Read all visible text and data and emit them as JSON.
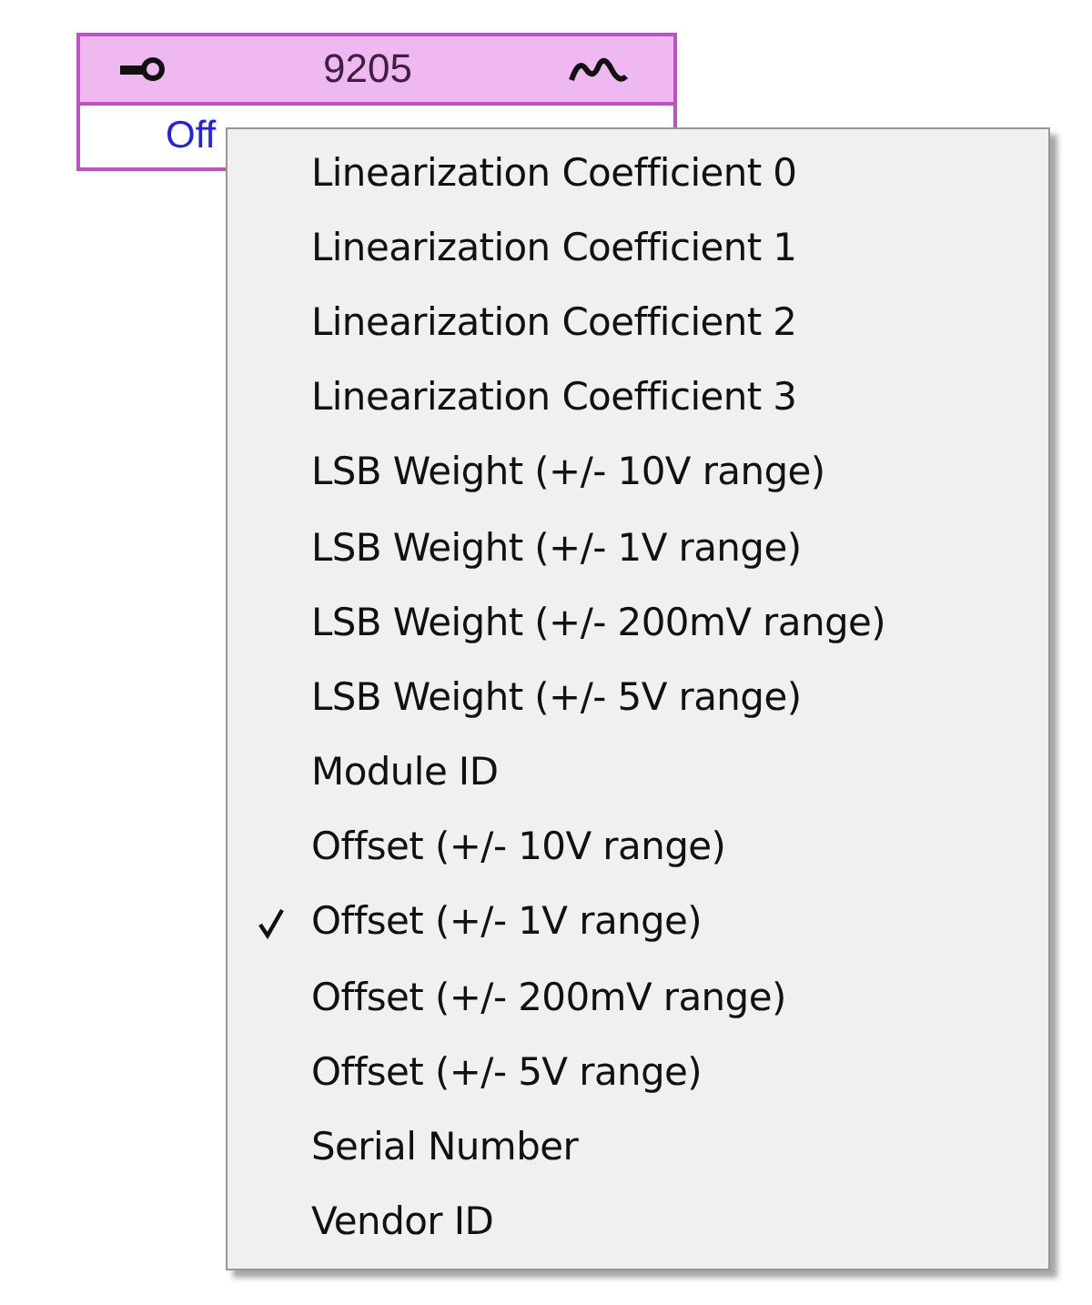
{
  "node": {
    "value": "9205",
    "property": "Off"
  },
  "menu": {
    "items": [
      {
        "label": "Linearization Coefficient 0",
        "checked": false
      },
      {
        "label": "Linearization Coefficient 1",
        "checked": false
      },
      {
        "label": "Linearization Coefficient 2",
        "checked": false
      },
      {
        "label": "Linearization Coefficient 3",
        "checked": false
      },
      {
        "label": "LSB Weight (+/- 10V range)",
        "checked": false
      },
      {
        "label": "LSB Weight (+/- 1V range)",
        "checked": false
      },
      {
        "label": "LSB Weight (+/- 200mV range)",
        "checked": false
      },
      {
        "label": "LSB Weight (+/- 5V range)",
        "checked": false
      },
      {
        "label": "Module ID",
        "checked": false
      },
      {
        "label": "Offset (+/- 10V range)",
        "checked": false
      },
      {
        "label": "Offset (+/- 1V range)",
        "checked": true
      },
      {
        "label": "Offset (+/- 200mV range)",
        "checked": false
      },
      {
        "label": "Offset (+/- 5V range)",
        "checked": false
      },
      {
        "label": "Serial Number",
        "checked": false
      },
      {
        "label": "Vendor ID",
        "checked": false
      }
    ]
  }
}
